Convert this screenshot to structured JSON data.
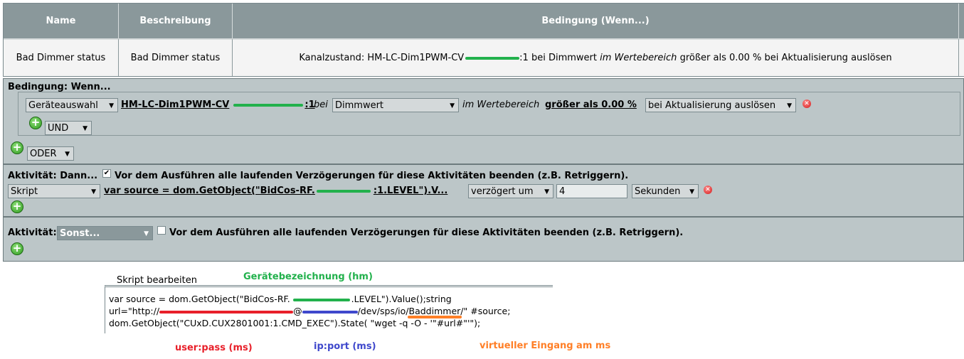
{
  "table": {
    "headers": [
      "Name",
      "Beschreibung",
      "Bedingung (Wenn...)"
    ],
    "row": {
      "name": "Bad Dimmer status",
      "description": "Bad Dimmer status",
      "condition_prefix": "Kanalzustand: HM-LC-Dim1PWM-CV",
      "condition_mid": ":1 bei Dimmwert",
      "condition_range": "im Wertebereich",
      "condition_suffix": "größer als 0.00 % bei Aktualisierung auslösen"
    }
  },
  "condition": {
    "title": "Bedingung: Wenn...",
    "device_select": "Geräteauswahl",
    "device_link": "HM-LC-Dim1PWM-CV",
    "device_link_channel": ":1",
    "bei": "bei",
    "param_select": "Dimmwert",
    "range_text": "im Wertebereich",
    "value_link": "größer als 0.00 %",
    "trigger_select": "bei Aktualisierung auslösen",
    "and_select": "UND",
    "or_select": "ODER"
  },
  "activity": {
    "title": "Aktivität: Dann...",
    "checkbox_label": "Vor dem Ausführen alle laufenden Verzögerungen für diese Aktivitäten beenden (z.B. Retriggern).",
    "checked": true,
    "type_select": "Skript",
    "script_link_start": "var source = dom.GetObject(\"BidCos-RF.",
    "script_link_end": ":1.LEVEL\").V...",
    "delay_select": "verzögert um",
    "delay_value": "4",
    "unit_select": "Sekunden"
  },
  "else_activity": {
    "title": "Aktivität:",
    "select": "Sonst...",
    "checkbox_label": "Vor dem Ausführen alle laufenden Verzögerungen für diese Aktivitäten beenden (z.B. Retriggern).",
    "checked": false
  },
  "script_editor": {
    "title": "Skript bearbeiten",
    "line1_start": "var source = dom.GetObject(\"BidCos-RF.",
    "line1_end": ".LEVEL\").Value();string",
    "line2_start": "url=\"http://",
    "line2_at": "@",
    "line2_end": "/dev/sps/io/",
    "line2_input": "Baddimmer",
    "line2_tail": "/\" #source;",
    "line3": "dom.GetObject(\"CUxD.CUX2801001:1.CMD_EXEC\").State( \"wget -q -O - '\"#url#\"'\");"
  },
  "annotations": {
    "device_label": "Gerätebezeichnung (hm)",
    "userpass_label": "user:pass (ms)",
    "ipport_label": "ip:port (ms)",
    "input_label": "virtueller Eingang am ms"
  },
  "colors": {
    "green": "#22b14c",
    "red": "#e8202a",
    "blue": "#3f48cc",
    "orange": "#ff7f27"
  }
}
